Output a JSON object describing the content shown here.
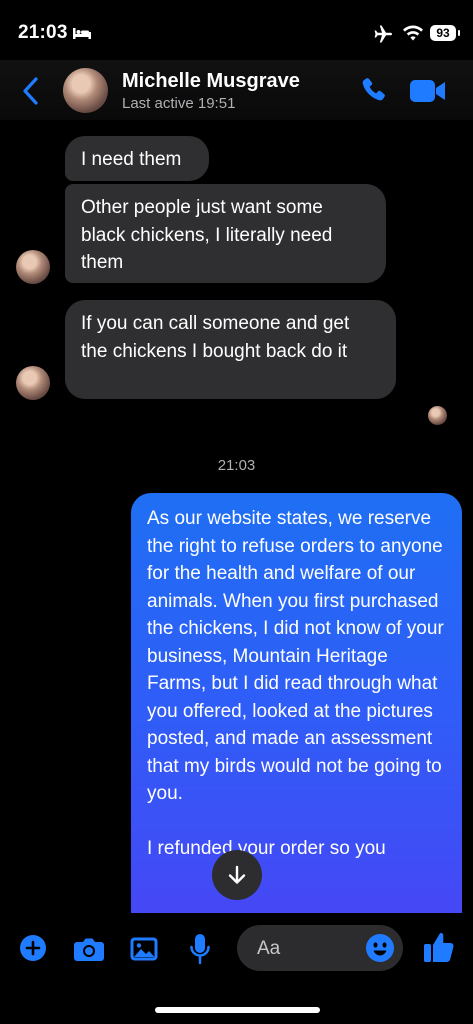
{
  "status_bar": {
    "time": "21:03",
    "battery": "93"
  },
  "header": {
    "name": "Michelle Musgrave",
    "last_active": "Last active 19:51"
  },
  "messages": {
    "received": [
      "I need them",
      "Other people just want some black chickens, I literally need them",
      "If you can call someone and get the chickens I bought back do it"
    ],
    "timestamp": "21:03",
    "sent_paragraphs": [
      "As our website states, we reserve the right to refuse orders to anyone for the health and welfare of our animals. When you first purchased the chickens, I did not know of your business, Mountain Heritage Farms, but I did read through what you offered, looked at the pictures posted, and made an assessment that my birds would not be going to you.",
      "I refunded your order so you"
    ]
  },
  "composer": {
    "placeholder": "Aa"
  },
  "icons": {
    "back": "chevron-left-icon",
    "call": "phone-icon",
    "video": "video-camera-icon",
    "plus": "plus-circle-icon",
    "camera": "camera-icon",
    "gallery": "image-icon",
    "mic": "microphone-icon",
    "emoji": "emoji-icon",
    "like": "thumbs-up-icon",
    "scroll": "arrow-down-icon"
  },
  "colors": {
    "accent": "#1f6ff4",
    "received_bubble": "#2f2f31",
    "background": "#000000"
  }
}
